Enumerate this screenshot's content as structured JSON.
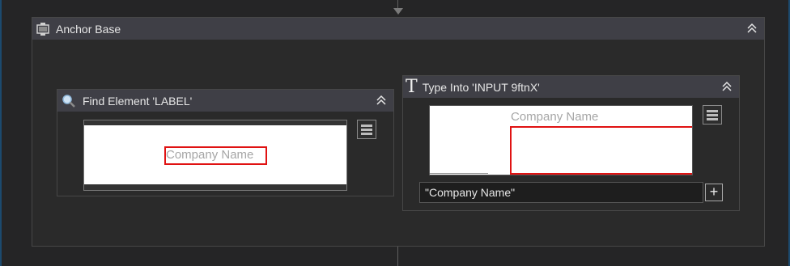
{
  "anchor_base": {
    "title": "Anchor Base",
    "icon": "anchor-base-icon"
  },
  "find_element": {
    "title": "Find Element 'LABEL'",
    "icon": "magnifier-icon",
    "screenshot_label": "Company Name"
  },
  "type_into": {
    "title": "Type Into 'INPUT  9ftnX'",
    "icon": "text-t-icon",
    "screenshot_label": "Company Name",
    "text_value": "\"Company Name\"",
    "add_label": "+"
  },
  "colors": {
    "canvas": "#252526",
    "header": "#3f3f46",
    "selection": "#e01212"
  }
}
